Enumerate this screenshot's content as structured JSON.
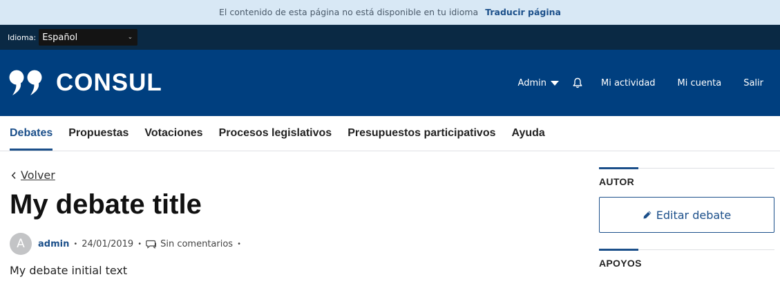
{
  "translation_banner": {
    "message": "El contenido de esta página no está disponible en tu idioma",
    "action_label": "Traducir página"
  },
  "locale": {
    "label": "Idioma:",
    "selected": "Español"
  },
  "header": {
    "logo_text": "CONSUL",
    "user_menu": {
      "admin_label": "Admin",
      "activity_label": "Mi actividad",
      "account_label": "Mi cuenta",
      "logout_label": "Salir"
    }
  },
  "main_nav": {
    "tabs": [
      {
        "label": "Debates",
        "active": true
      },
      {
        "label": "Propuestas",
        "active": false
      },
      {
        "label": "Votaciones",
        "active": false
      },
      {
        "label": "Procesos legislativos",
        "active": false
      },
      {
        "label": "Presupuestos participativos",
        "active": false
      },
      {
        "label": "Ayuda",
        "active": false
      }
    ]
  },
  "debate": {
    "back_label": "Volver",
    "title": "My debate title",
    "avatar_initial": "A",
    "author": "admin",
    "date": "24/01/2019",
    "comments_label": "Sin comentarios",
    "body": "My debate initial text"
  },
  "sidebar": {
    "author_heading": "AUTOR",
    "edit_label": "Editar debate",
    "supports_heading": "APOYOS"
  },
  "colors": {
    "brand_header": "#003f7f",
    "locale_bar": "#0a2944",
    "translation_banner": "#d8e8f5",
    "accent": "#1b4f8a"
  },
  "icons": [
    "quote-logo-icon",
    "caret-down-icon",
    "bell-icon",
    "chevron-left-icon",
    "comment-icon",
    "pencil-icon",
    "select-chevron-icon"
  ]
}
